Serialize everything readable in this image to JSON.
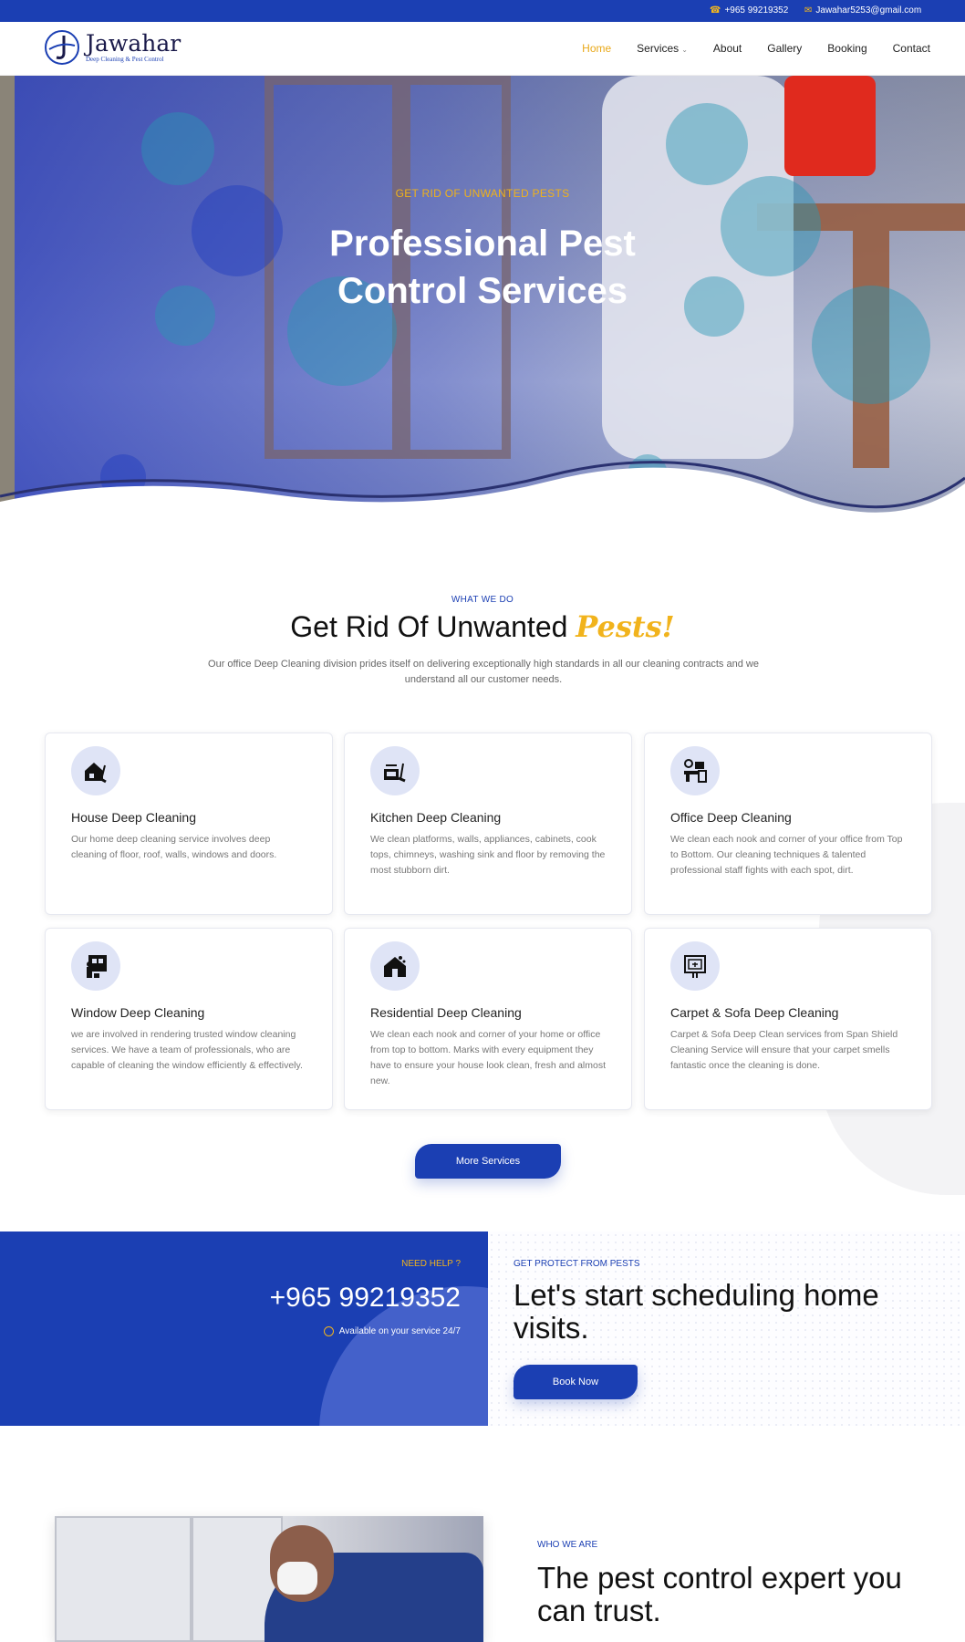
{
  "topbar": {
    "phone": "+965 99219352",
    "email": "Jawahar5253@gmail.com",
    "bg_color": "#1b3fb3",
    "accent_color": "#f1b31c"
  },
  "logo": {
    "name": "Jawahar",
    "tagline": "Deep Cleaning & Pest Control"
  },
  "nav": {
    "items": [
      {
        "label": "Home",
        "active": true
      },
      {
        "label": "Services",
        "dropdown": true
      },
      {
        "label": "About"
      },
      {
        "label": "Gallery"
      },
      {
        "label": "Booking"
      },
      {
        "label": "Contact"
      }
    ]
  },
  "hero": {
    "subtitle": "GET RID OF UNWANTED PESTS",
    "title_line1": "Professional Pest",
    "title_line2": "Control Services"
  },
  "what_we_do": {
    "kicker": "WHAT WE DO",
    "title": "Get Rid Of Unwanted",
    "title_accent": "Pests!",
    "description": "Our office Deep Cleaning division prides itself on delivering exceptionally high standards in all our cleaning contracts and we understand all our customer needs.",
    "services": [
      {
        "icon": "house-cleaning-icon",
        "title": "House Deep Cleaning",
        "text": "Our home deep cleaning service involves deep cleaning of floor, roof, walls, windows and doors."
      },
      {
        "icon": "kitchen-cleaning-icon",
        "title": "Kitchen Deep Cleaning",
        "text": "We clean platforms, walls, appliances, cabinets, cook tops, chimneys, washing sink and floor by removing the most stubborn dirt."
      },
      {
        "icon": "office-cleaning-icon",
        "title": "Office Deep Cleaning",
        "text": "We clean each nook and corner of your office from Top to Bottom. Our cleaning techniques & talented professional staff fights with each spot, dirt."
      },
      {
        "icon": "window-cleaning-icon",
        "title": "Window Deep Cleaning",
        "text": "we are involved in rendering trusted window cleaning services. We have a team of professionals, who are capable of cleaning the window efficiently & effectively."
      },
      {
        "icon": "residential-cleaning-icon",
        "title": "Residential Deep Cleaning",
        "text": "We clean each nook and corner of your home or office from top to bottom. Marks with every equipment they have to ensure your house look clean, fresh and almost new."
      },
      {
        "icon": "carpet-sofa-cleaning-icon",
        "title": "Carpet & Sofa Deep Cleaning",
        "text": "Carpet & Sofa Deep Clean services from Span Shield Cleaning Service will ensure that your carpet smells fantastic once the cleaning is done."
      }
    ],
    "more_button": "More Services"
  },
  "help": {
    "kicker": "NEED HELP ?",
    "phone": "+965 99219352",
    "availability": "Available on your service 24/7"
  },
  "schedule": {
    "kicker": "GET PROTECT FROM PESTS",
    "title": "Let's start scheduling home visits.",
    "button": "Book Now"
  },
  "who": {
    "kicker": "WHO WE ARE",
    "title": "The pest control expert you can trust."
  }
}
